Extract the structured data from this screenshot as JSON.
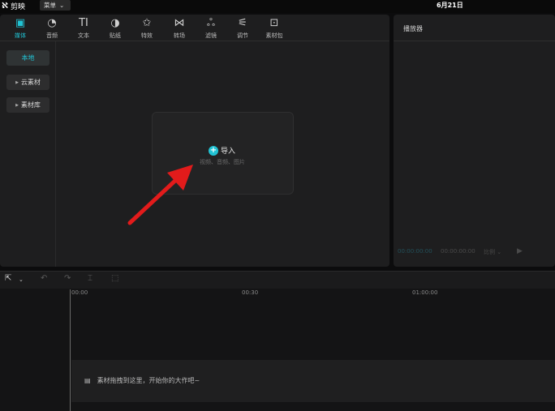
{
  "titlebar": {
    "app_name": "剪映",
    "menu_label": "菜单",
    "date": "6月21日"
  },
  "toolbar": {
    "items": [
      {
        "label": "媒体",
        "icon": "media-icon",
        "glyph": "▣"
      },
      {
        "label": "音频",
        "icon": "audio-icon",
        "glyph": "◔"
      },
      {
        "label": "文本",
        "icon": "text-icon",
        "glyph": "TI"
      },
      {
        "label": "贴纸",
        "icon": "sticker-icon",
        "glyph": "◑"
      },
      {
        "label": "特效",
        "icon": "effect-icon",
        "glyph": "✩"
      },
      {
        "label": "转场",
        "icon": "transition-icon",
        "glyph": "⋈"
      },
      {
        "label": "滤镜",
        "icon": "filter-icon",
        "glyph": "ஃ"
      },
      {
        "label": "调节",
        "icon": "adjust-icon",
        "glyph": "⚟"
      },
      {
        "label": "素材包",
        "icon": "pack-icon",
        "glyph": "⊡"
      }
    ]
  },
  "sidebar": {
    "local": "本地",
    "cloud": "云素材",
    "library": "素材库"
  },
  "import": {
    "label": "导入",
    "hint": "视频、音频、图片"
  },
  "player": {
    "title": "播放器",
    "current_time": "00:00:00:00",
    "total_time": "00:00:00:00",
    "ratio": "比例"
  },
  "timeline": {
    "ticks": [
      "00:00",
      "00:30",
      "01:00:00"
    ],
    "hint": "素材拖拽到这里，开始你的大作吧~"
  },
  "colors": {
    "accent": "#21c3d4",
    "annotation_arrow": "#e21b1b"
  }
}
